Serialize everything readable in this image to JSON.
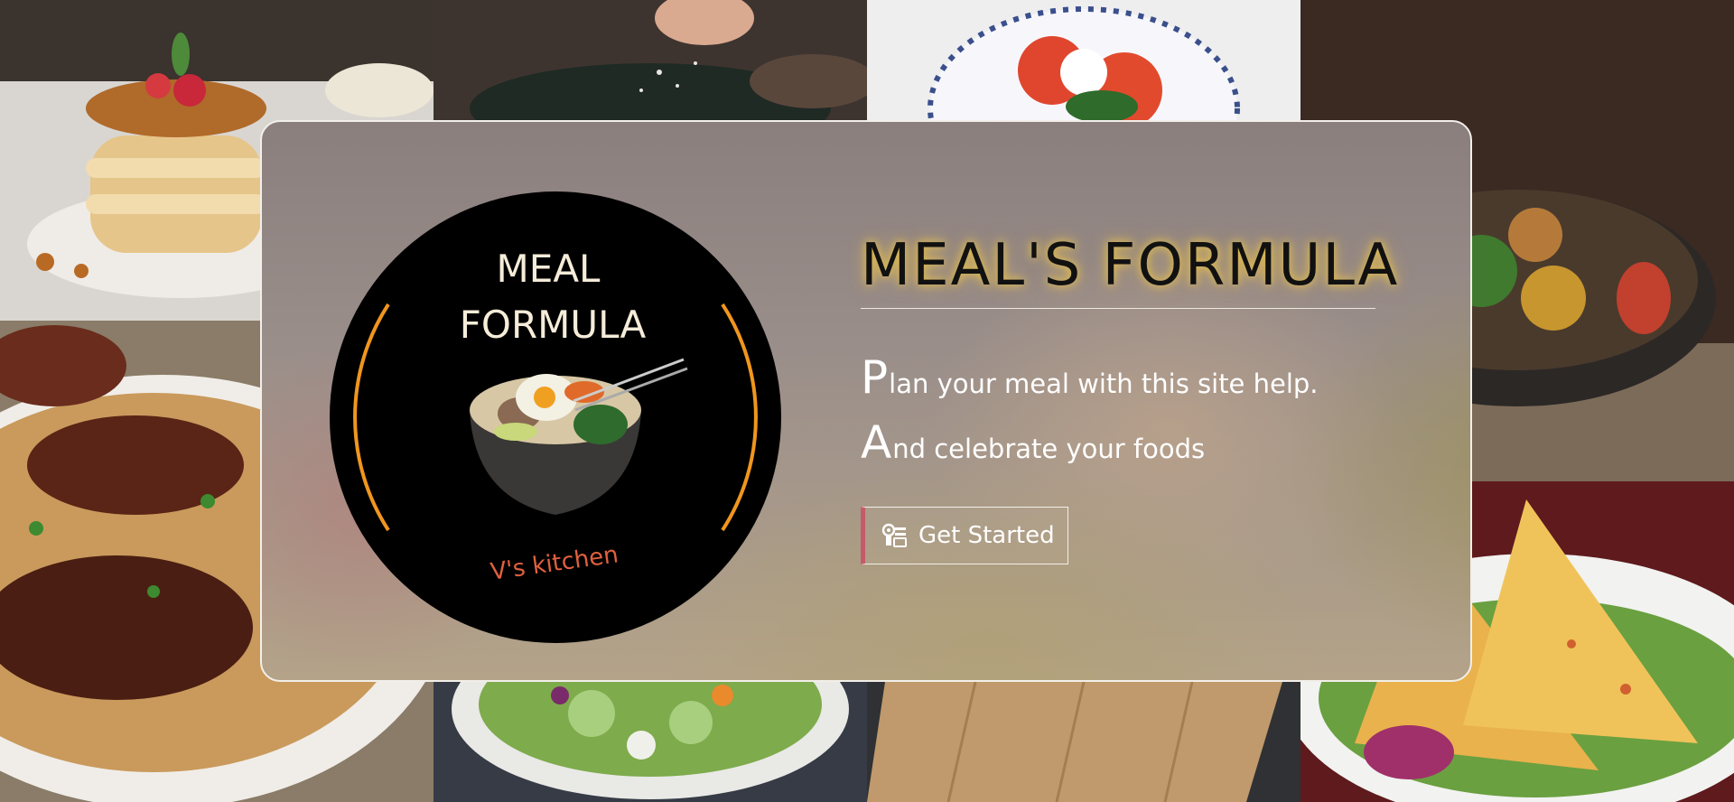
{
  "background": {
    "tiles": [
      {
        "name": "pancakes-photo"
      },
      {
        "name": "seasoning-photo"
      },
      {
        "name": "caprese-plate-photo"
      },
      {
        "name": "veggie-bowl-photo"
      },
      {
        "name": "biryani-photo"
      },
      {
        "name": "salad-bowl-photo"
      },
      {
        "name": "cutting-board-photo"
      },
      {
        "name": "samosa-photo"
      }
    ]
  },
  "logo": {
    "title_line1": "MEAL",
    "title_line2": "FORMULA",
    "subtitle": "V's kitchen",
    "ring_color": "#f0961e"
  },
  "hero": {
    "title": "MEAL'S FORMULA",
    "tagline1": {
      "cap": "P",
      "rest": "lan your meal with this site help."
    },
    "tagline2": {
      "cap": "A",
      "rest": "nd celebrate your foods"
    },
    "cta_label": "Get Started",
    "cta_icon": "recipe-card-icon",
    "accent": "#c45a6a"
  }
}
